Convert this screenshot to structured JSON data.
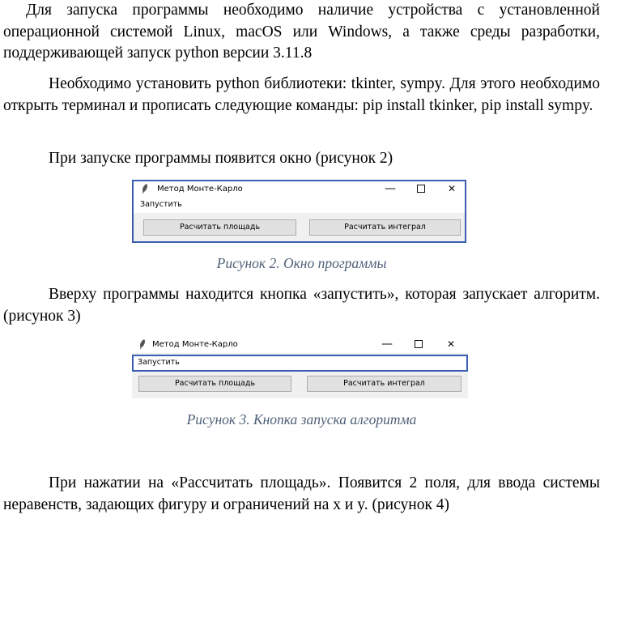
{
  "paragraphs": {
    "p1": "Для запуска программы необходимо наличие устройства с установленной операционной системой Linux, macOS или Windows, а также среды разработки, поддерживающей запуск python версии 3.11.8",
    "p2": "Необходимо установить python библиотеки: tkinter, sympy. Для этого необходимо открыть терминал и прописать следующие команды: pip install tkinker, pip install sympy.",
    "p3": "При запуске программы появится окно (рисунок 2)",
    "p4": "Вверху программы находится кнопка «запустить», которая запускает алгоритм. (рисунок 3)",
    "p5": "При нажатии на «Рассчитать площадь». Появится 2 поля, для ввода системы неравенств, задающих фигуру и ограничений на x и y. (рисунок 4)"
  },
  "figure2": {
    "window_title": "Метод Монте-Карло",
    "menu_run": "Запустить",
    "btn_area": "Расчитать площадь",
    "btn_integral": "Расчитать интеграл",
    "caption": "Рисунок 2. Окно программы"
  },
  "figure3": {
    "window_title": "Метод Монте-Карло",
    "menu_run": "Запустить",
    "btn_area": "Расчитать площадь",
    "btn_integral": "Расчитать интеграл",
    "caption": "Рисунок 3. Кнопка запуска алгоритма"
  },
  "window_controls": {
    "minimize": "—",
    "close": "✕"
  },
  "colors": {
    "caption": "#4f6078",
    "highlight_border": "#3a5fb0",
    "window_bg": "#f0f0f0"
  }
}
